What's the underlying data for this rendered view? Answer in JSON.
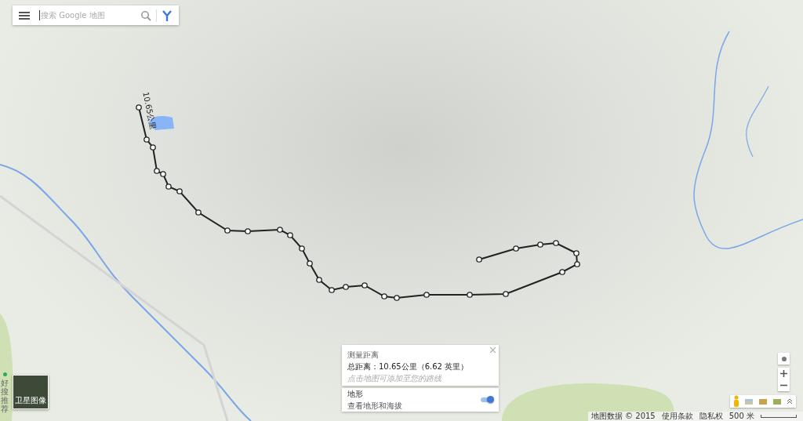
{
  "search": {
    "placeholder": "搜索 Google 地图"
  },
  "route": {
    "label": "10.65公里"
  },
  "measure_card": {
    "title": "测量距离",
    "total": "总距离：10.65公里（6.62 英里）",
    "hint": "点击地图可添加至您的路线"
  },
  "layer_card": {
    "title": "地形",
    "subtitle": "查看地形和海拔",
    "on": true
  },
  "satellite": {
    "label": "卫星图像"
  },
  "side_tab": {
    "label": "好搜推荐"
  },
  "footer": {
    "items": [
      "地图数据 © 2015",
      "使用条款",
      "隐私权"
    ],
    "scale": "500 米"
  }
}
